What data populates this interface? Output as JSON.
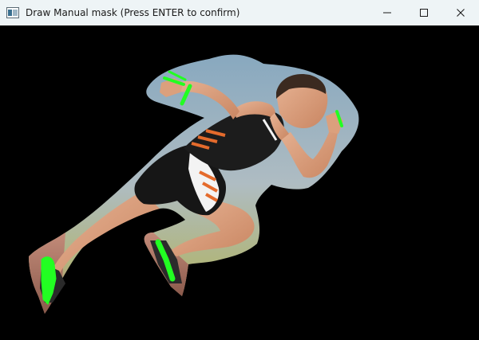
{
  "window": {
    "title": "Draw Manual mask (Press ENTER to confirm)",
    "app_icon": "opencv-window-icon",
    "controls": {
      "minimize_icon": "minimize-icon",
      "maximize_icon": "maximize-icon",
      "close_icon": "close-icon"
    }
  },
  "canvas": {
    "background": "#000000",
    "image_subject": "sprinter-image",
    "mask_stroke_color": "#22ff22"
  }
}
